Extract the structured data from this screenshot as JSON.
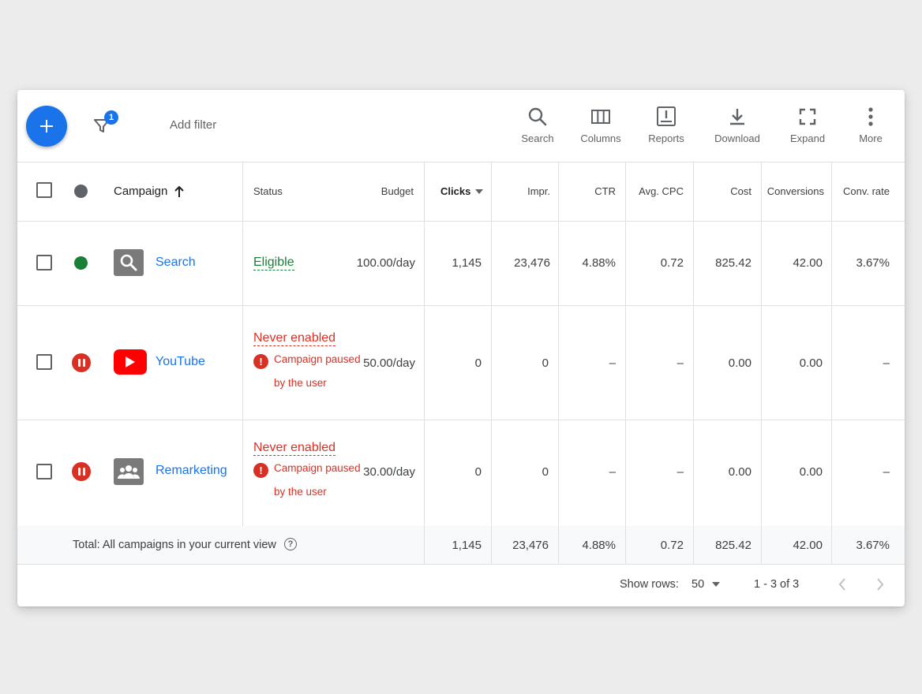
{
  "toolbar": {
    "add_filter_placeholder": "Add filter",
    "filter_count": "1",
    "tools": [
      {
        "label": "Search",
        "icon": "search-icon"
      },
      {
        "label": "Columns",
        "icon": "columns-icon"
      },
      {
        "label": "Reports",
        "icon": "reports-icon"
      },
      {
        "label": "Download",
        "icon": "download-icon"
      },
      {
        "label": "Expand",
        "icon": "expand-icon"
      },
      {
        "label": "More",
        "icon": "more-vert-icon"
      }
    ]
  },
  "columns": {
    "campaign": "Campaign",
    "status": "Status",
    "budget": "Budget",
    "clicks": "Clicks",
    "impr": "Impr.",
    "ctr": "CTR",
    "avg_cpc": "Avg. CPC",
    "cost": "Cost",
    "conversions": "Conversions",
    "conv_rate": "Conv. rate"
  },
  "rows": [
    {
      "campaign": "Search",
      "status": "Eligible",
      "budget": "100.00/day",
      "clicks": "1,145",
      "impr": "23,476",
      "ctr": "4.88%",
      "avg_cpc": "0.72",
      "cost": "825.42",
      "conversions": "42.00",
      "conv_rate": "3.67%"
    },
    {
      "campaign": "YouTube",
      "status": "Never enabled",
      "status_note": "Campaign paused by the user",
      "budget": "50.00/day",
      "clicks": "0",
      "impr": "0",
      "ctr": "–",
      "avg_cpc": "–",
      "cost": "0.00",
      "conversions": "0.00",
      "conv_rate": "–"
    },
    {
      "campaign": "Remarketing",
      "status": "Never enabled",
      "status_note": "Campaign paused by the user",
      "budget": "30.00/day",
      "clicks": "0",
      "impr": "0",
      "ctr": "–",
      "avg_cpc": "–",
      "cost": "0.00",
      "conversions": "0.00",
      "conv_rate": "–"
    }
  ],
  "total": {
    "label": "Total: All campaigns in your current view",
    "clicks": "1,145",
    "impr": "23,476",
    "ctr": "4.88%",
    "avg_cpc": "0.72",
    "cost": "825.42",
    "conversions": "42.00",
    "conv_rate": "3.67%"
  },
  "pagination": {
    "show_rows_label": "Show rows:",
    "rows_value": "50",
    "range": "1 - 3 of 3"
  },
  "colors": {
    "accent": "#1a73e8",
    "eligible": "#188038",
    "error": "#d93025"
  }
}
